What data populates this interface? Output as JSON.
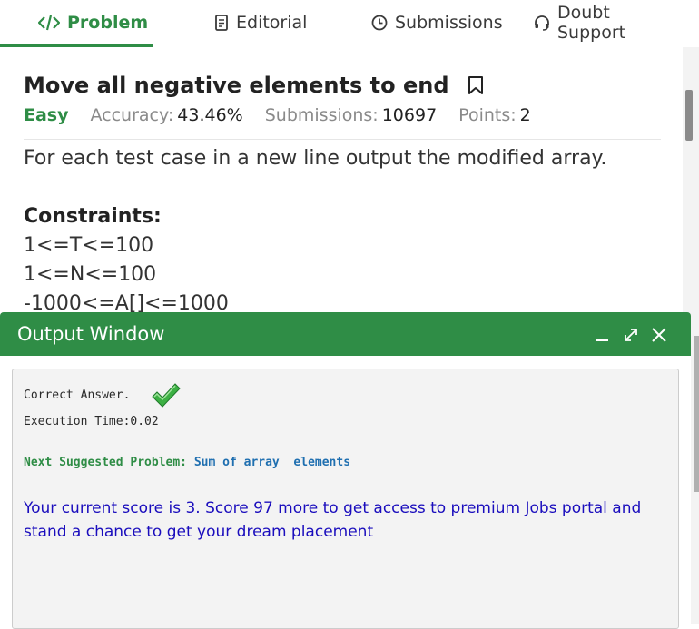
{
  "tabs": [
    {
      "label": "Problem",
      "icon": "code-icon",
      "active": true
    },
    {
      "label": "Editorial",
      "icon": "document-icon"
    },
    {
      "label": "Submissions",
      "icon": "clock-icon"
    },
    {
      "label": "Doubt Support",
      "icon": "headset-icon"
    }
  ],
  "problem": {
    "title": "Move all negative elements to end",
    "difficulty": "Easy",
    "accuracy_label": "Accuracy:",
    "accuracy_value": "43.46%",
    "submissions_label": "Submissions:",
    "submissions_value": "10697",
    "points_label": "Points:",
    "points_value": "2",
    "output_desc": "For each test case in a new line output the modified array.",
    "constraints_title": "Constraints:",
    "constraints": [
      "1<=T<=100",
      "1<=N<=100",
      "-1000<=A[]<=1000"
    ]
  },
  "output_window": {
    "title": "Output Window",
    "result": "Correct Answer.",
    "execution_time": "Execution Time:0.02",
    "next_label": "Next Suggested Problem:",
    "next_problem": "Sum of array  elements",
    "score_message": "Your current score is 3. Score 97 more to get access to premium Jobs portal and stand a chance to get your dream placement"
  },
  "colors": {
    "accent": "#2f8d46",
    "link": "#1f6fb0",
    "score_text": "#1a0dbd"
  }
}
